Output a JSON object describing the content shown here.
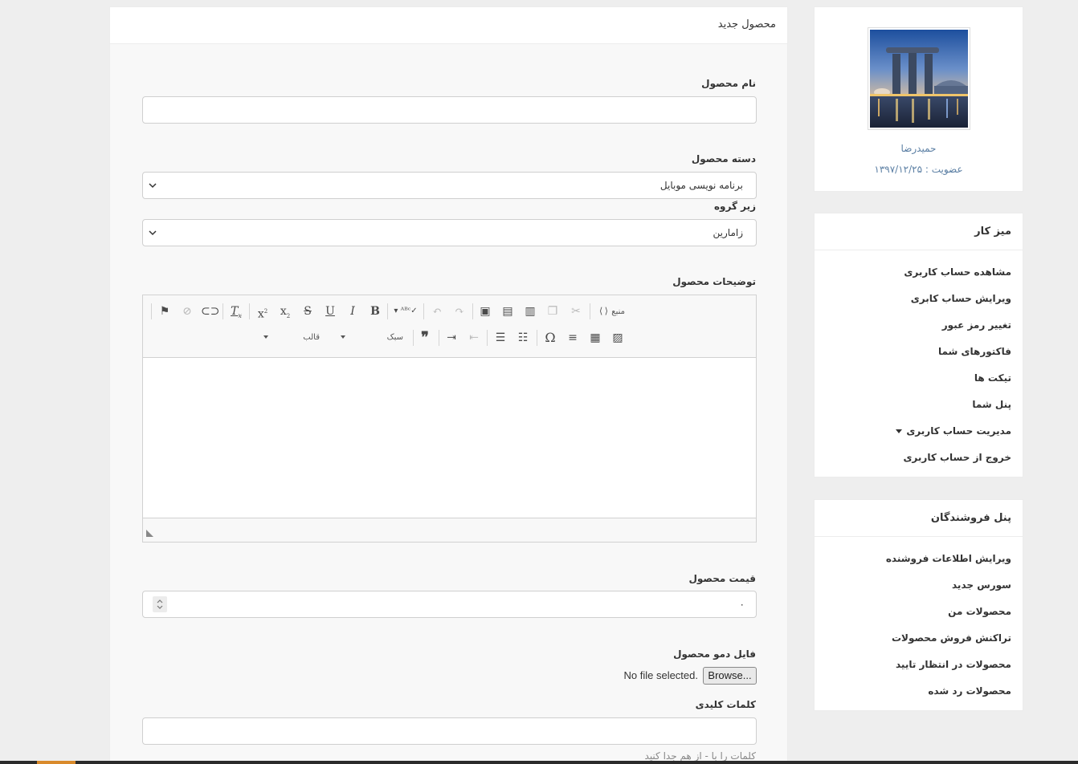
{
  "main": {
    "header_title": "محصول جدید",
    "product_name": {
      "label": "نام محصول",
      "value": ""
    },
    "category": {
      "label": "دسته محصول",
      "selected": "برنامه نویسی موبایل"
    },
    "subgroup": {
      "label": "زیر گروه",
      "selected": "زامارین"
    },
    "description": {
      "label": "توضیحات محصول",
      "toolbar": {
        "source_label": "منبع",
        "style_label": "سبک",
        "format_label": "قالب",
        "buttons_row1": [
          "source-icon",
          "cut-icon",
          "copy-icon",
          "paste-icon",
          "paste-text-icon",
          "paste-word-icon",
          "undo-icon",
          "redo-icon",
          "spellcheck-icon",
          "bold-icon",
          "italic-icon",
          "underline-icon",
          "strikethrough-icon",
          "subscript-icon",
          "superscript-icon",
          "remove-format-icon",
          "link-icon",
          "unlink-icon",
          "anchor-icon"
        ],
        "buttons_row2": [
          "image-icon",
          "table-icon",
          "horizontal-rule-icon",
          "special-char-icon",
          "numbered-list-icon",
          "bulleted-list-icon",
          "outdent-icon",
          "indent-icon",
          "blockquote-icon"
        ]
      }
    },
    "price": {
      "label": "قیمت محصول",
      "value": "۰"
    },
    "demo_file": {
      "label": "فایل دمو محصول",
      "browse_label": "Browse...",
      "status": "No file selected."
    },
    "keywords": {
      "label": "کلمات کلیدی",
      "value": "",
      "hint": "کلمات را با - از هم جدا کنید"
    }
  },
  "profile": {
    "name": "حمیدرضا",
    "membership": "عضویت : ۱۳۹۷/۱۲/۲۵"
  },
  "dashboard_menu": {
    "title": "میز کار",
    "items": [
      "مشاهده حساب کاربری",
      "ویرایش حساب کابری",
      "تغییر رمز عبور",
      "فاکتورهای شما",
      "تیکت ها",
      "پنل شما",
      "مدیریت حساب کاربری",
      "خروج از حساب کاربری"
    ]
  },
  "seller_menu": {
    "title": "پنل فروشندگان",
    "items": [
      "ویرایش اطلاعات فروشنده",
      "سورس جدید",
      "محصولات من",
      "تراکنش فروش محصولات",
      "محصولات در انتظار تایید",
      "محصولات رد شده"
    ]
  },
  "colors": {
    "link_blue": "#5a7ea3",
    "card_bg": "#ffffff",
    "page_bg": "#eeeeee"
  }
}
